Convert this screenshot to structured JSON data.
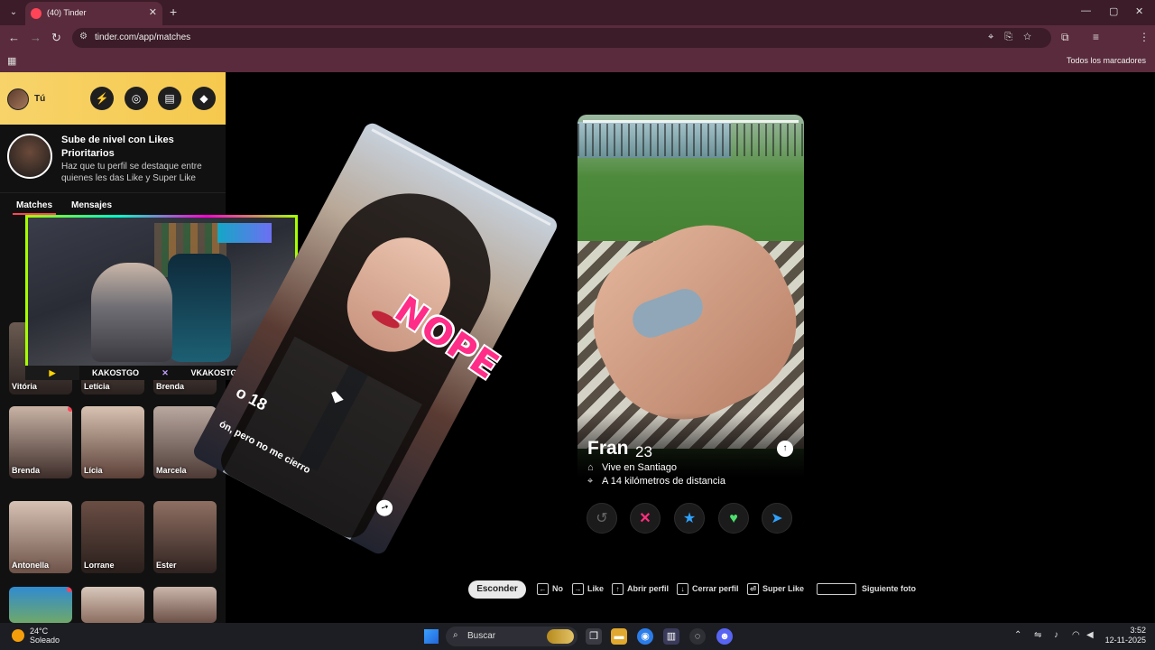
{
  "browser": {
    "tab_title": "(40) Tinder",
    "new_tab": "+",
    "url": "tinder.com/app/matches",
    "bookmarks_all": "Todos los marcadores",
    "window_controls": [
      "—",
      "▢",
      "✕"
    ]
  },
  "sidebar": {
    "me_label": "Tú",
    "promo_title": "Sube de nivel con Likes Prioritarios",
    "promo_sub": "Haz que tu perfil se destaque entre quienes les das Like y Super Like",
    "tab_matches": "Matches",
    "tab_messages": "Mensajes",
    "matches_row1": [
      {
        "name": "Vitória"
      },
      {
        "name": "Letícia"
      },
      {
        "name": "Brenda"
      }
    ],
    "matches_row2": [
      {
        "name": "Brenda"
      },
      {
        "name": "Lícia"
      },
      {
        "name": "Marcela"
      }
    ],
    "matches_row3": [
      {
        "name": "Antonella"
      },
      {
        "name": "Lorrane"
      },
      {
        "name": "Ester"
      }
    ]
  },
  "stream": {
    "left_name": "KAKOSTGO",
    "right_name": "VKAKOSTGO"
  },
  "left_card": {
    "stamp": "NOPE",
    "age_fragment": "o 18",
    "bio_fragment": "ón, pero no me cierro"
  },
  "right_card": {
    "name": "Fran",
    "age": "23",
    "lives": "Vive en Santiago",
    "distance": "A 14 kilómetros de distancia"
  },
  "hints": {
    "hide": "Esconder",
    "no": "No",
    "like": "Like",
    "open_profile": "Abrir perfil",
    "close_profile": "Cerrar perfil",
    "super_like": "Super Like",
    "next_photo": "Siguiente foto"
  },
  "taskbar": {
    "temp": "24°C",
    "weather": "Soleado",
    "search": "Buscar",
    "time": "3:52",
    "date": "12-11-2025"
  }
}
